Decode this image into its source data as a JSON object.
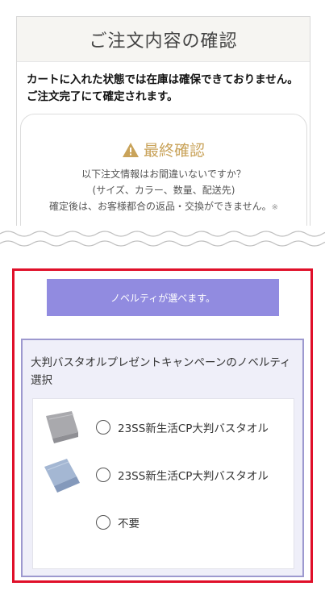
{
  "confirm": {
    "title": "ご注文内容の確認",
    "notice": "カートに入れた状態では在庫は確保できておりません。ご注文完了にて確定されます。",
    "final_title": "最終確認",
    "final_lines": [
      "以下注文情報はお間違いないですか？",
      "(サイズ、カラー、数量、配送先)",
      "確定後は、お客様都合の返品・交換ができません。"
    ],
    "final_mark": "※"
  },
  "novelty": {
    "banner": "ノベルティが選べます。",
    "campaign_title": "大判バスタオルプレゼントキャンペーンのノベルティ選択",
    "options": [
      {
        "label": "23SS新生活CP大判バスタオル",
        "thumb_color": "#a9a9ad",
        "icon": "gray-towel-thumbnail"
      },
      {
        "label": "23SS新生活CP大判バスタオル",
        "thumb_color": "#9fb2cf",
        "icon": "blue-towel-thumbnail"
      },
      {
        "label": "不要"
      }
    ]
  },
  "colors": {
    "accent_banner": "#918be0",
    "frame_red": "#e0102a",
    "final_gold": "#c9a35a"
  }
}
